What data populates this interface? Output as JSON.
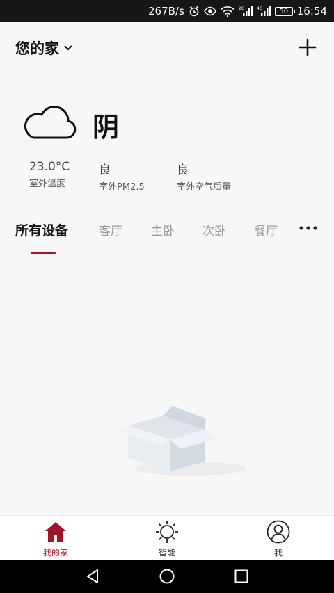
{
  "status_bar": {
    "speed": "267B/s",
    "signal_2g": "2G",
    "signal_4g": "4G",
    "battery": "50",
    "time": "16:54"
  },
  "header": {
    "title": "您的家",
    "add_icon": "plus-icon"
  },
  "weather": {
    "condition": "阴",
    "icon": "cloud-icon",
    "stats": [
      {
        "value": "23.0°C",
        "label": "室外温度"
      },
      {
        "value": "良",
        "label": "室外PM2.5"
      },
      {
        "value": "良",
        "label": "室外空气质量"
      }
    ]
  },
  "tabs": [
    {
      "label": "所有设备",
      "active": true
    },
    {
      "label": "客厅",
      "active": false
    },
    {
      "label": "主卧",
      "active": false
    },
    {
      "label": "次卧",
      "active": false
    },
    {
      "label": "餐厅",
      "active": false
    }
  ],
  "bottom_nav": [
    {
      "label": "我的家",
      "icon": "home-icon",
      "active": true
    },
    {
      "label": "智能",
      "icon": "sun-icon",
      "active": false
    },
    {
      "label": "我",
      "icon": "user-icon",
      "active": false
    }
  ],
  "colors": {
    "accent": "#a4132c",
    "background": "#f7f7f7",
    "status_bar": "#171717"
  }
}
